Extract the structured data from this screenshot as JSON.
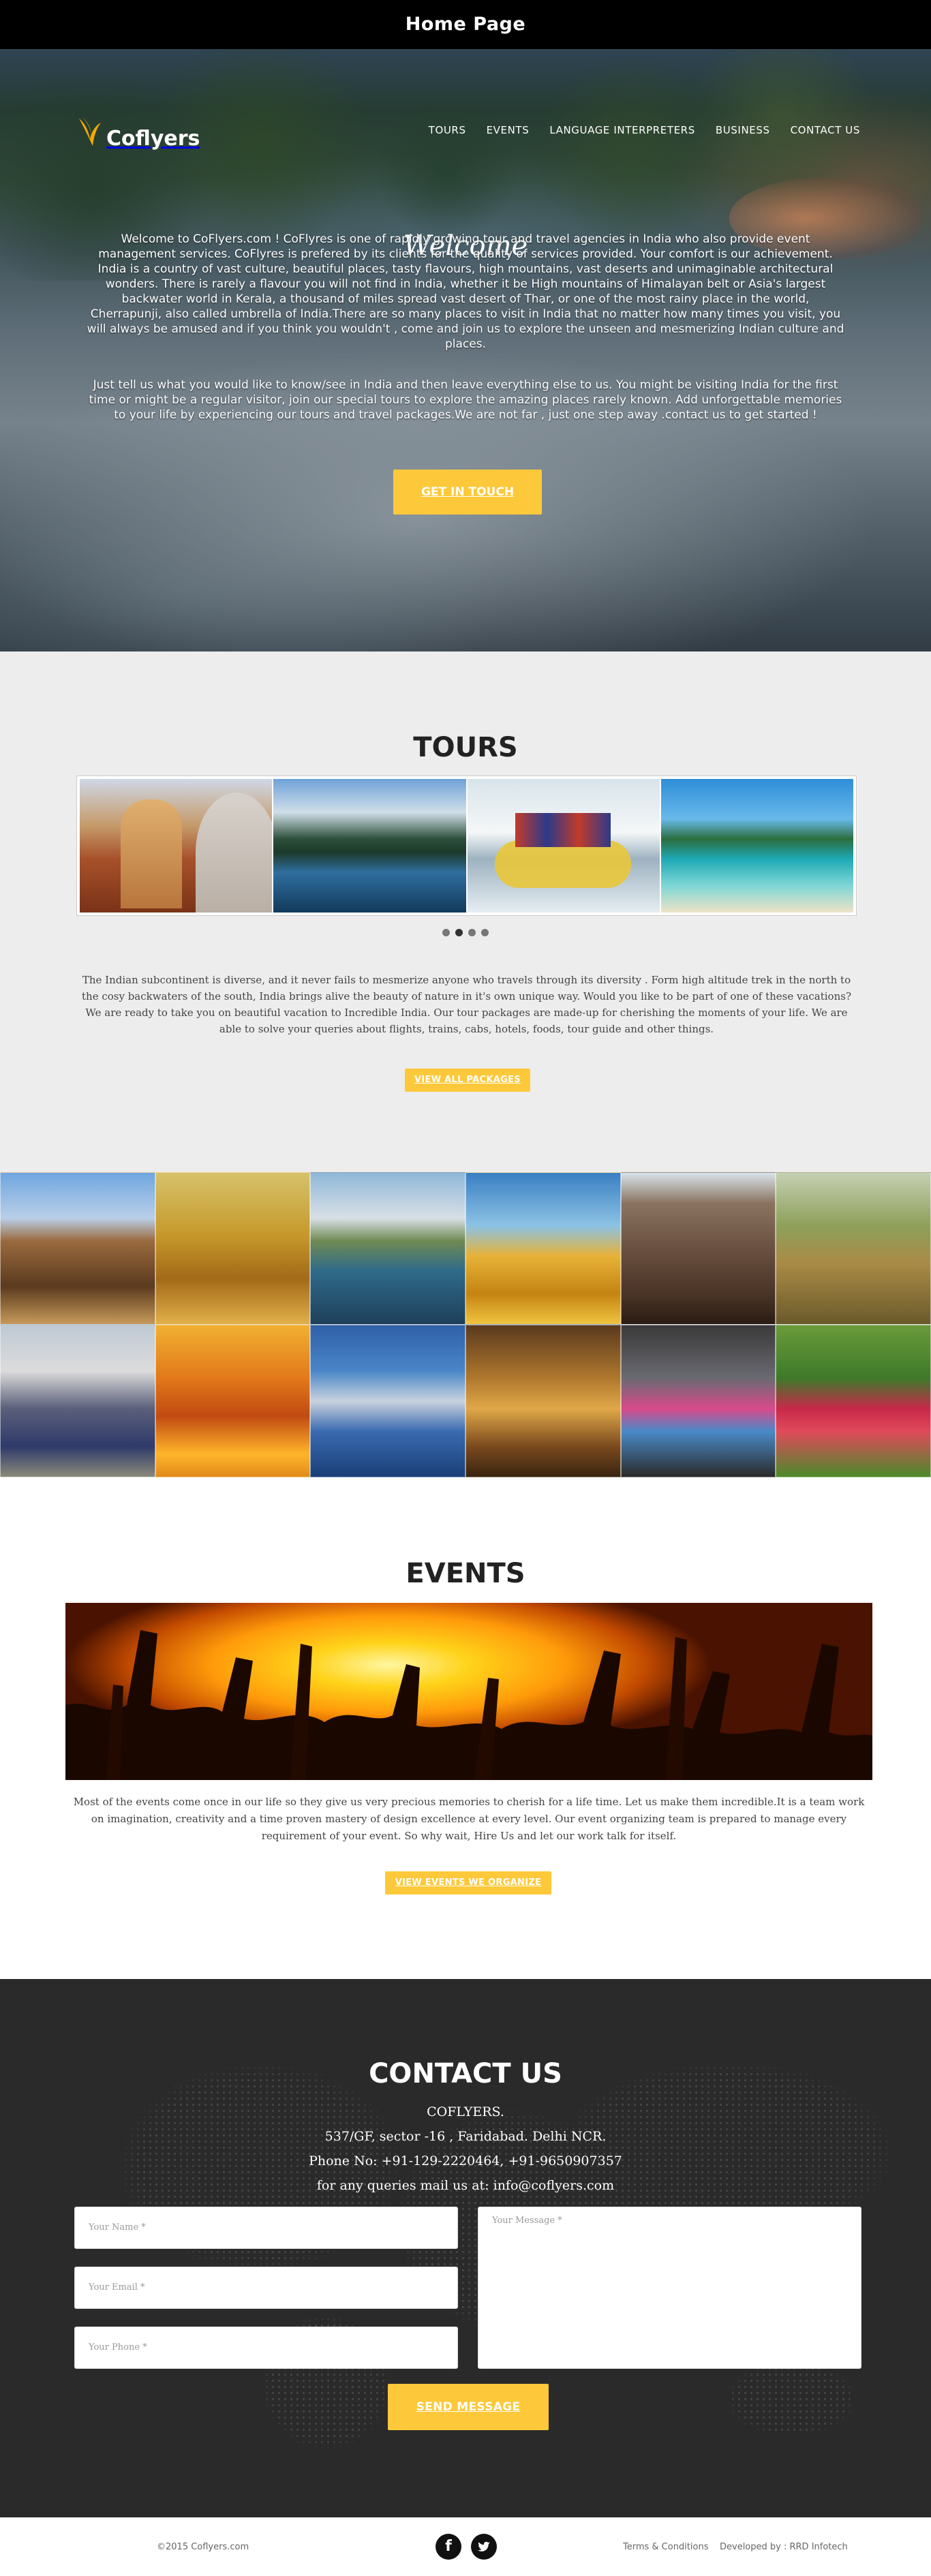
{
  "page": {
    "title": "Home Page"
  },
  "header": {
    "logo_text": "Coflyers",
    "nav": [
      "TOURS",
      "EVENTS",
      "LANGUAGE INTERPRETERS",
      "BUSINESS",
      "CONTACT US"
    ]
  },
  "hero": {
    "heading": "Welcome",
    "paragraph1": "Welcome to CoFlyers.com ! CoFlyres is one of rapidly growing tour and travel agencies in India who also provide event management services. CoFlyres is prefered by its clients for the quality of services provided. Your comfort is our achievement. India is a country of vast culture, beautiful places, tasty flavours, high mountains, vast deserts and unimaginable architectural wonders. There is rarely a flavour you will not find in India, whether it be High mountains of Himalayan belt or Asia's largest backwater world in Kerala, a thousand of miles spread vast desert of Thar, or one of the most rainy place in the world, Cherrapunji, also called umbrella of India.There are so many places to visit in India that no matter how many times you visit, you will always be amused and if you think you wouldn't , come and join us to explore the unseen and mesmerizing Indian culture and places.",
    "paragraph2": "Just tell us what you would like to know/see in India and then leave everything else to us. You might be visiting India for the first time or might be a regular visitor, join our special tours to explore the amazing places rarely known. Add unforgettable memories to your life by experiencing our tours and travel packages.We are not far , just one step away .contact us to get started !",
    "cta": "GET IN TOUCH"
  },
  "tours": {
    "heading": "TOURS",
    "paragraph": "The Indian subcontinent is diverse, and it never fails to mesmerize anyone who travels through its diversity . Form high altitude trek in the north to the cosy backwaters of the south, India brings alive the beauty of nature in it's own unique way. Would you like to be part of one of these vacations? We are ready to take you on beautiful vacation to Incredible India. Our tour packages are made-up for cherishing the moments of your life. We are able to solve your queries about flights, trains, cabs, hotels, foods, tour guide and other things.",
    "button": "VIEW ALL PACKAGES",
    "carousel_dots": 4,
    "active_dot": 1
  },
  "events": {
    "heading": "EVENTS",
    "paragraph": "Most of the events come once in our life so they give us very precious memories to cherish for a life time. Let us make them incredible.It is a team work on imagination, creativity and a time proven mastery of design excellence at every level. Our event organizing team is prepared to manage every requirement of your event. So why wait, Hire Us and let our work talk for itself.",
    "button": "VIEW EVENTS WE ORGANIZE"
  },
  "contact": {
    "heading": "CONTACT US",
    "company": "COFLYERS.",
    "address": "537/GF, sector -16 , Faridabad. Delhi NCR.",
    "phone": "Phone No: +91-129-2220464, +91-9650907357",
    "email": "for any queries mail us at: info@coflyers.com",
    "name_placeholder": "Your Name *",
    "email_placeholder": "Your Email *",
    "phone_placeholder": "Your Phone *",
    "message_placeholder": "Your Message *",
    "send": "SEND MESSAGE"
  },
  "footer": {
    "copyright": "©2015 Coflyers.com",
    "terms": "Terms & Conditions",
    "developed_by": "Developed by : RRD Infotech"
  },
  "colors": {
    "accent": "#fdc93a",
    "dark": "#2a2a2a"
  }
}
